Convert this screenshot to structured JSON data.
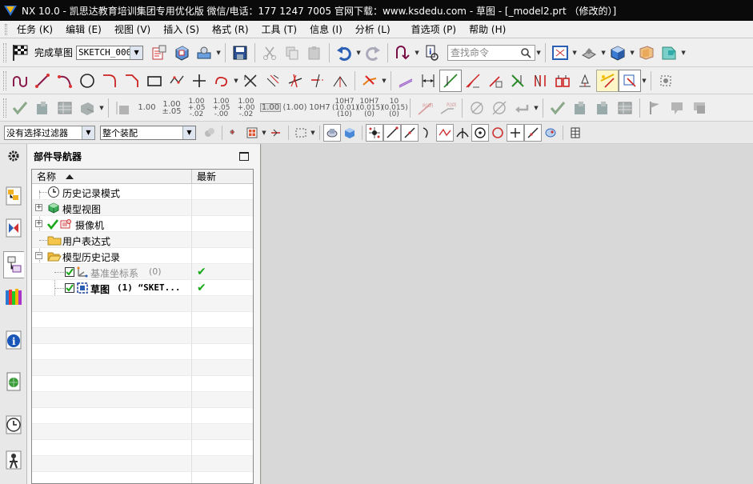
{
  "window": {
    "title": "NX 10.0 - 凯思达教育培训集团专用优化版 微信/电话：177 1247 7005    官网下载：www.ksdedu.com - 草图 - [_model2.prt （修改的）]"
  },
  "menubar": {
    "items": [
      "任务 (K)",
      "编辑 (E)",
      "视图 (V)",
      "插入 (S)",
      "格式 (R)",
      "工具 (T)",
      "信息 (I)",
      "分析 (L)",
      "首选项 (P)",
      "帮助 (H)"
    ]
  },
  "toolbar1": {
    "finish_sketch_label": "完成草图",
    "sketch_name": "SKETCH_000",
    "search_placeholder": "查找命令"
  },
  "toolbar3": {
    "dim_values": [
      "1.00",
      "1.00\n±.05",
      "1.00\n+.05\n-.02",
      "1.00\n+.05\n-.00",
      "1.00\n+.00\n-.02",
      "1.00",
      "(1.00)",
      "10H7",
      "10H7\n(10.01)\n(10)",
      "10H7\n(0.015)\n(0)",
      "10\n(0.015)\n(0)"
    ]
  },
  "toolbar4": {
    "filter_value": "没有选择过滤器",
    "scope_value": "整个装配"
  },
  "navigator": {
    "title": "部件导航器",
    "col_name": "名称",
    "col_latest": "最新",
    "rows": [
      {
        "label": "历史记录模式",
        "icon": "clock-icon"
      },
      {
        "label": "模型视图",
        "icon": "model-view-icon"
      },
      {
        "label": "摄像机",
        "icon": "camera-icon"
      },
      {
        "label": "用户表达式",
        "icon": "folder-icon"
      },
      {
        "label": "模型历史记录",
        "icon": "folder-open-icon"
      },
      {
        "label": "基准坐标系",
        "suffix": "(0)",
        "icon": "datum-csys-icon",
        "latest": "✔"
      },
      {
        "label": "草图",
        "suffix": "(1) “SKET...",
        "icon": "sketch-icon",
        "latest": "✔"
      }
    ]
  },
  "colors": {
    "titlebar_bg": "#0a0a0a",
    "toolbar_bg": "#efefef",
    "graphics_bg": "#d8d8d8",
    "check_green": "#18a818"
  }
}
